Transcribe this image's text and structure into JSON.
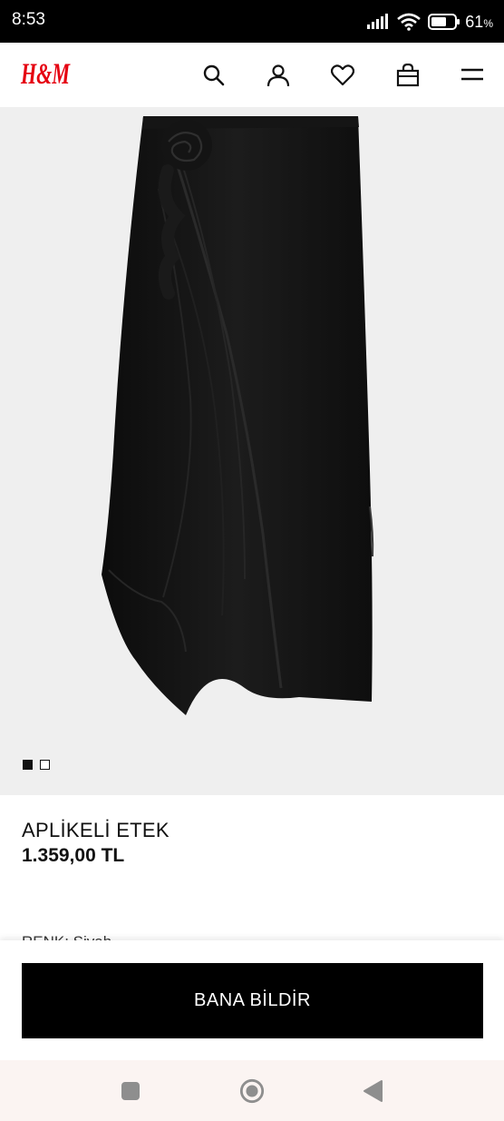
{
  "status_bar": {
    "time": "8:53",
    "battery_percent": "61",
    "battery_unit": "%",
    "icons": [
      "signal-icon",
      "wifi-icon",
      "battery-icon"
    ]
  },
  "header": {
    "logo_text": "H&M",
    "brand_color": "#e50010",
    "icons": [
      "search-icon",
      "account-icon",
      "favorites-icon",
      "cart-icon",
      "menu-icon"
    ]
  },
  "gallery": {
    "image_count": 2,
    "active_index": 0
  },
  "product": {
    "title": "APLİKELİ ETEK",
    "price": "1.359,00 TL",
    "color_label_partial": "RENK: Siyah"
  },
  "cta": {
    "notify_label": "BANA BİLDİR"
  },
  "system_nav": {
    "icons": [
      "recents-icon",
      "home-icon",
      "back-icon"
    ]
  }
}
